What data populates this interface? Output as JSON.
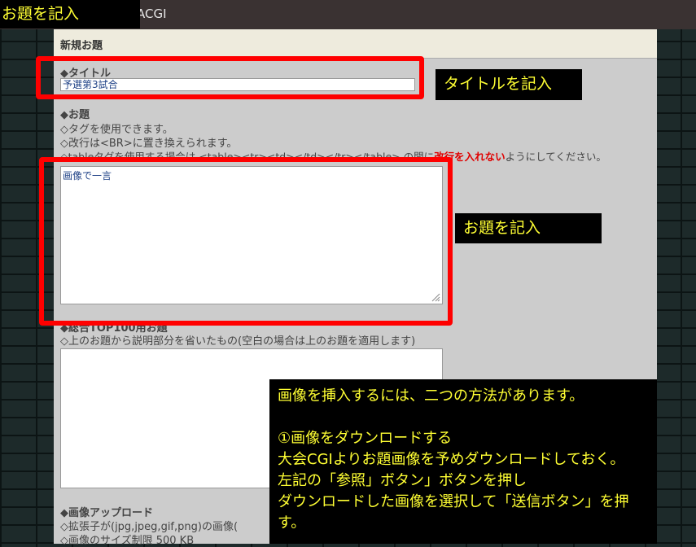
{
  "topbar": {
    "title_visible": "ACGI"
  },
  "callout_topleft": "お題を記入",
  "panel": {
    "header": "新規お題",
    "title_label": "◆タイトル",
    "title_value": "予選第3試合",
    "odai_label": "◆お題",
    "odai_hint1": "◇タグを使用できます。",
    "odai_hint2": "◇改行は<BR>に置き換えられます。",
    "odai_hint3_pre": "◇tableタグを使用する場合は",
    "odai_hint3_tags": "<table><tr><td></td></tr></table>",
    "odai_hint3_mid": "の間に",
    "odai_hint3_red": "改行を入れない",
    "odai_hint3_post": "ようにしてください。",
    "odai_value": "画像で一言",
    "top100_label": "◆総合TOP100用お題",
    "top100_hint": "◇上のお題から説明部分を省いたもの(空白の場合は上のお題を適用します)",
    "upload_label": "◆画像アップロード",
    "upload_hint1": "◇拡張子が(jpg,jpeg,gif,png)の画像(",
    "upload_hint2": "◇画像のサイズ制限 500 KB"
  },
  "notes": {
    "title_note": "タイトルを記入",
    "odai_note": "お題を記入",
    "big_note": [
      "画像を挿入するには、二つの方法があります。",
      "",
      "①画像をダウンロードする",
      "大会CGIよりお題画像を予めダウンロードしておく。",
      "左記の「参照」ボタン」ボタンを押し",
      "ダウンロードした画像を選択して「送信ボタン」を押",
      "す。"
    ]
  },
  "colors": {
    "highlight": "#ff0000",
    "note_text": "#ffff33",
    "note_bg": "#000000"
  }
}
